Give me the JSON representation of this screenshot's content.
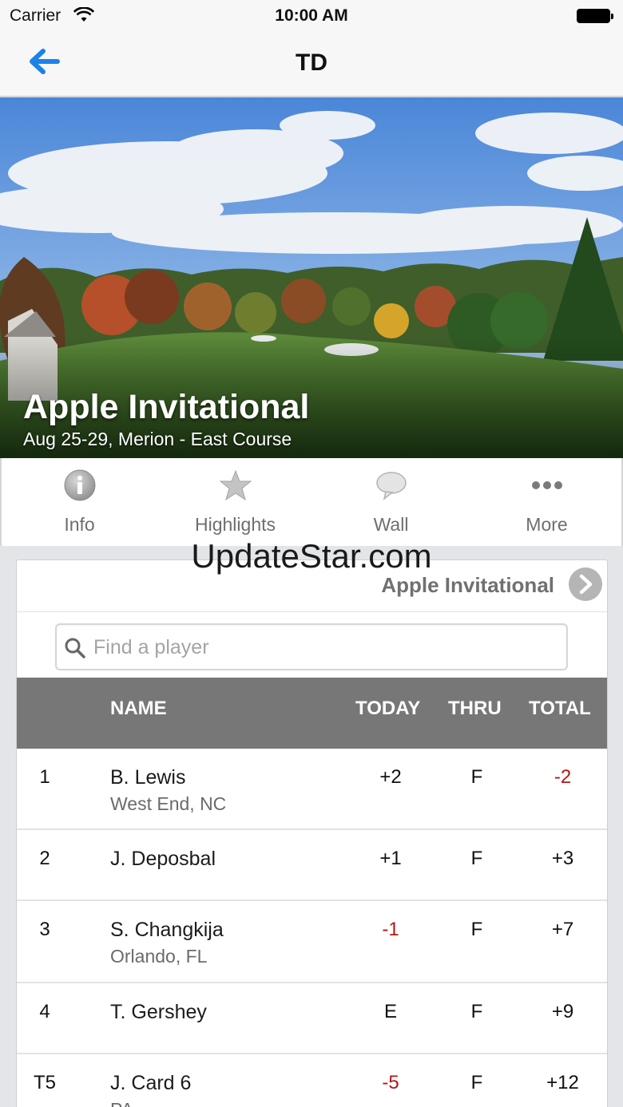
{
  "status_bar": {
    "carrier": "Carrier",
    "time": "10:00 AM"
  },
  "nav": {
    "title": "TD",
    "back_icon": "arrow-left-icon",
    "accent": "#1a83e8"
  },
  "hero": {
    "title": "Apple Invitational",
    "subtitle": "Aug 25-29, Merion - East Course"
  },
  "tabs": [
    {
      "label": "Info",
      "icon": "info-icon"
    },
    {
      "label": "Highlights",
      "icon": "star-icon"
    },
    {
      "label": "Wall",
      "icon": "speech-bubble-icon"
    },
    {
      "label": "More",
      "icon": "more-dots-icon"
    }
  ],
  "watermark": "UpdateStar.com",
  "leaderboard": {
    "header_title": "Apple Invitational",
    "search_placeholder": "Find a player",
    "columns": {
      "name": "NAME",
      "today": "TODAY",
      "thru": "THRU",
      "total": "TOTAL"
    },
    "rows": [
      {
        "pos": "1",
        "name": "B. Lewis",
        "location": "West End, NC",
        "today": "+2",
        "thru": "F",
        "total": "-2"
      },
      {
        "pos": "2",
        "name": "J. Deposbal",
        "location": "",
        "today": "+1",
        "thru": "F",
        "total": "+3"
      },
      {
        "pos": "3",
        "name": "S. Changkija",
        "location": "Orlando, FL",
        "today": "-1",
        "thru": "F",
        "total": "+7"
      },
      {
        "pos": "4",
        "name": "T. Gershey",
        "location": "",
        "today": "E",
        "thru": "F",
        "total": "+9"
      },
      {
        "pos": "T5",
        "name": "J. Card 6",
        "location": "PA",
        "today": "-5",
        "thru": "F",
        "total": "+12"
      }
    ],
    "negative_color": "#b81414"
  }
}
